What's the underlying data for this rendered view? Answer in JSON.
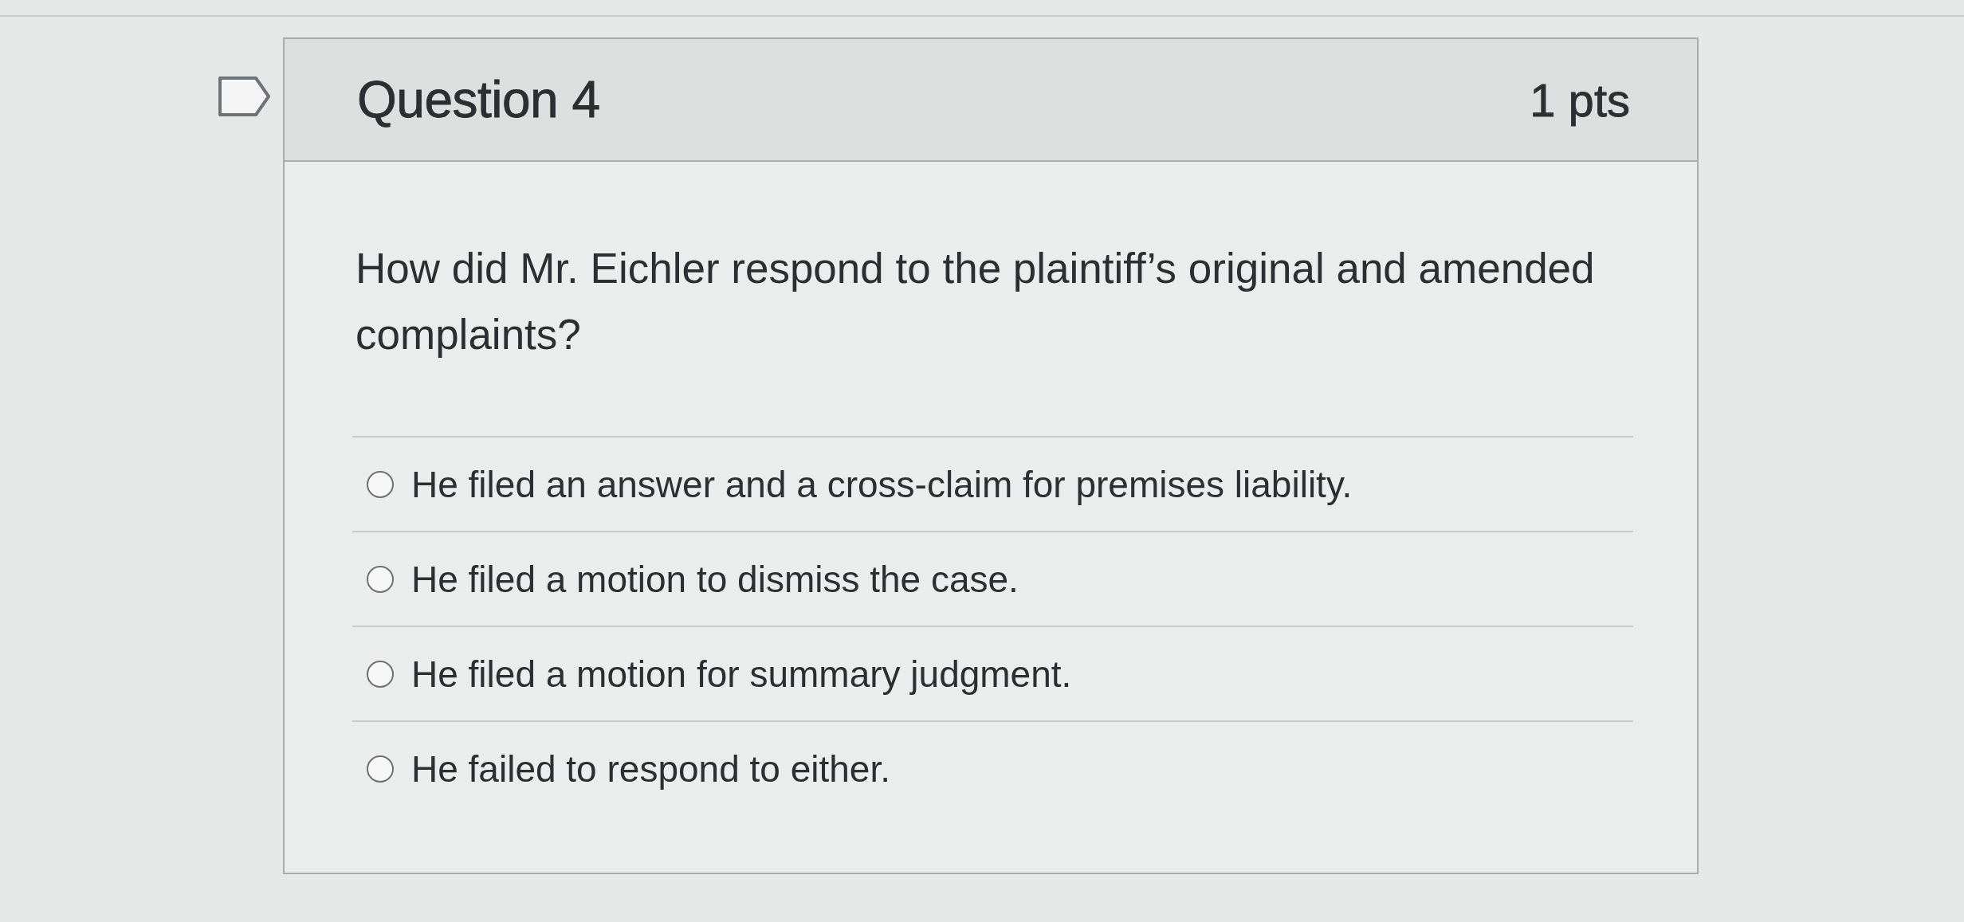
{
  "question": {
    "title": "Question 4",
    "points": "1 pts",
    "text": "How did Mr. Eichler respond to the plaintiff’s original and amended complaints?",
    "answers": [
      {
        "label": "He filed an answer and a cross-claim for premises liability.",
        "selected": false
      },
      {
        "label": "He filed a motion to dismiss the case.",
        "selected": false
      },
      {
        "label": "He filed a motion for summary judgment.",
        "selected": false
      },
      {
        "label": "He failed to respond to either.",
        "selected": false
      }
    ]
  }
}
